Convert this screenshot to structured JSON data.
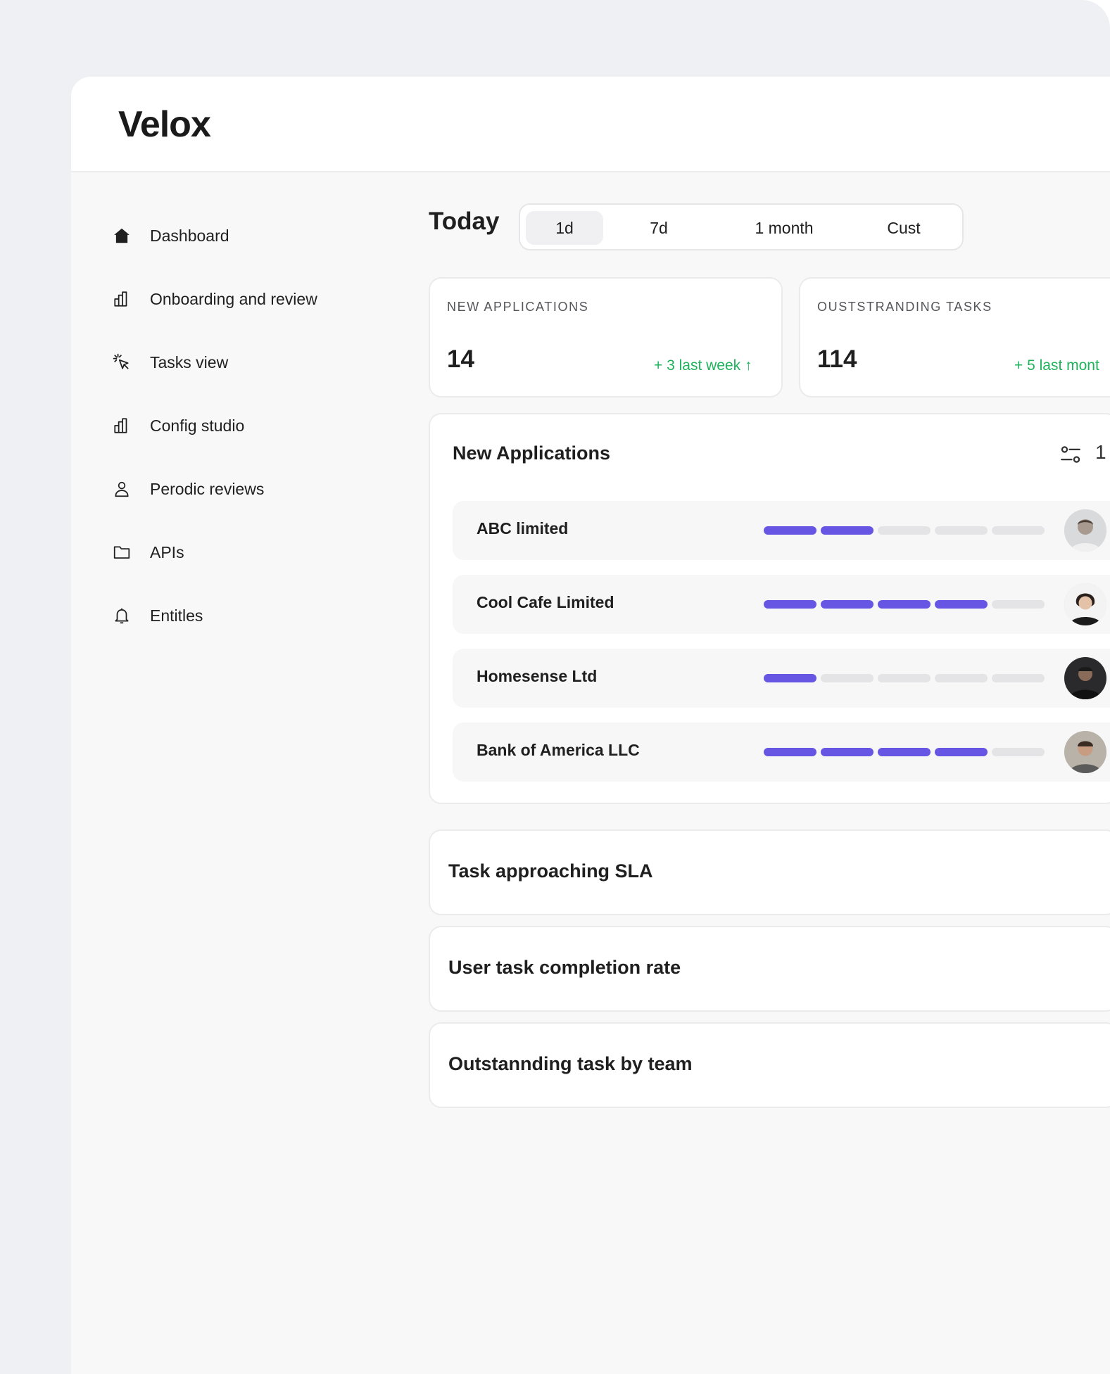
{
  "app": {
    "logo": "Velox"
  },
  "sidebar": {
    "items": [
      {
        "label": "Dashboard",
        "icon": "home-icon"
      },
      {
        "label": "Onboarding and review",
        "icon": "bar-chart-icon"
      },
      {
        "label": "Tasks view",
        "icon": "cursor-click-icon"
      },
      {
        "label": "Config studio",
        "icon": "bar-chart-icon"
      },
      {
        "label": "Perodic reviews",
        "icon": "user-icon"
      },
      {
        "label": "APIs",
        "icon": "folder-icon"
      },
      {
        "label": "Entitles",
        "icon": "bell-icon"
      }
    ]
  },
  "main": {
    "heading": "Today",
    "ranges": [
      "1d",
      "7d",
      "1 month",
      "Cust"
    ],
    "active_range": "1d",
    "stats": [
      {
        "label": "NEW APPLICATIONS",
        "value": "14",
        "change": "+ 3 last week ↑"
      },
      {
        "label": "OUSTSTRANDING TASKS",
        "value": "114",
        "change": "+ 5 last mont"
      }
    ],
    "new_applications": {
      "title": "New Applications",
      "count": "1",
      "filter_icon": "filter-icon",
      "accent_color": "#6756e3",
      "rows": [
        {
          "name": "ABC limited",
          "progress": 2,
          "steps": 5
        },
        {
          "name": "Cool Cafe Limited",
          "progress": 4,
          "steps": 5
        },
        {
          "name": "Homesense Ltd",
          "progress": 1,
          "steps": 5
        },
        {
          "name": "Bank of America LLC",
          "progress": 4,
          "steps": 5
        }
      ]
    },
    "sections": [
      {
        "title": "Task approaching SLA"
      },
      {
        "title": "User task completion rate"
      },
      {
        "title": "Outstannding task by team"
      }
    ]
  }
}
